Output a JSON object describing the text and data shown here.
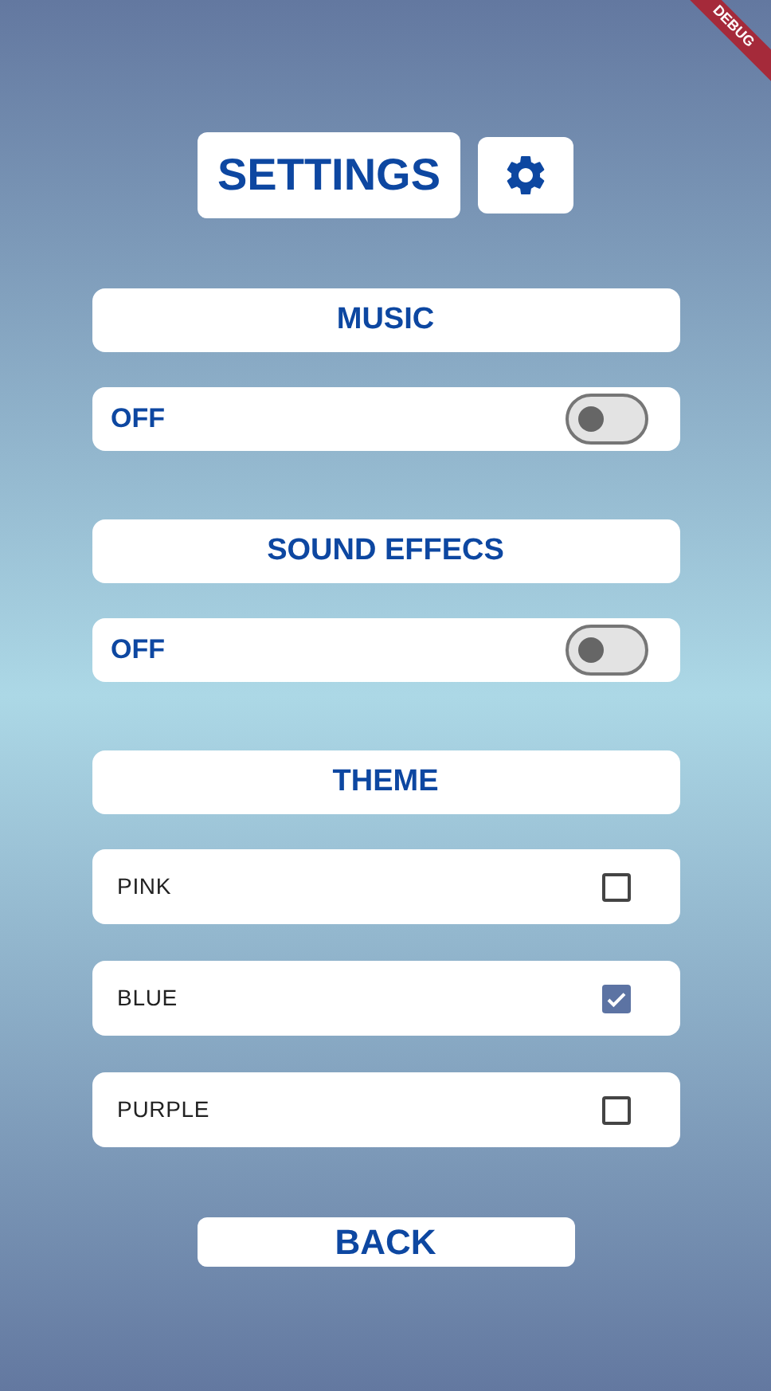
{
  "debug_banner": "DEBUG",
  "title": "SETTINGS",
  "sections": [
    {
      "kind": "toggle",
      "heading": "MUSIC",
      "label": "OFF",
      "on": false
    },
    {
      "kind": "toggle",
      "heading": "SOUND EFFECS",
      "label": "OFF",
      "on": false
    },
    {
      "kind": "choices",
      "heading": "THEME",
      "options": [
        {
          "label": "PINK",
          "checked": false
        },
        {
          "label": "BLUE",
          "checked": true
        },
        {
          "label": "PURPLE",
          "checked": false
        }
      ]
    }
  ],
  "back_button": "BACK"
}
